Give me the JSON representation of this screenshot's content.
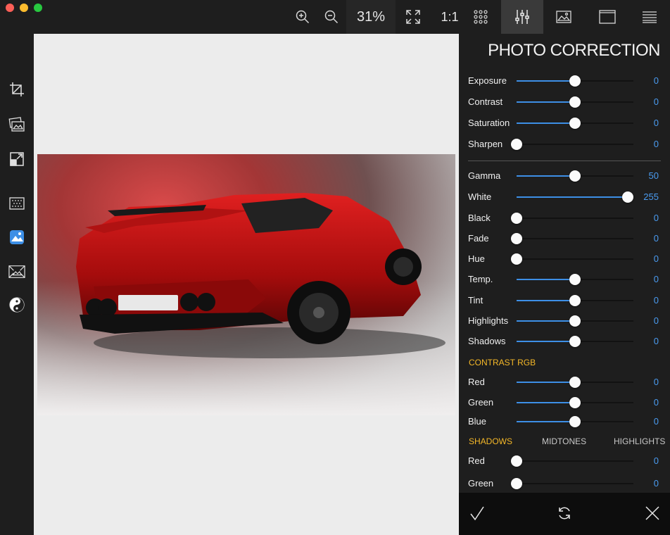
{
  "toolbar": {
    "zoom_in_icon": "zoom-in-icon",
    "zoom_out_icon": "zoom-out-icon",
    "zoom_level": "31%",
    "fit_icon": "fit-screen-icon",
    "actual_size": "1:1",
    "grid_icon": "grid-icon",
    "adjust_icon": "sliders-icon",
    "image_icon": "image-icon",
    "window_icon": "window-icon",
    "menu_icon": "menu-icon"
  },
  "sidebar": {
    "items": [
      {
        "icon": "crop-icon"
      },
      {
        "icon": "photo-effects-icon"
      },
      {
        "icon": "resize-icon"
      },
      {
        "icon": "texture-icon"
      },
      {
        "icon": "photo-correction-icon"
      },
      {
        "icon": "perspective-icon"
      },
      {
        "icon": "yin-yang-icon"
      }
    ]
  },
  "panel": {
    "title": "PHOTO CORRECTION",
    "basic": [
      {
        "label": "Exposure",
        "value": "0",
        "level": 0.5
      },
      {
        "label": "Contrast",
        "value": "0",
        "level": 0.5
      },
      {
        "label": "Saturation",
        "value": "0",
        "level": 0.5
      },
      {
        "label": "Sharpen",
        "value": "0",
        "level": 0.0
      }
    ],
    "tone": [
      {
        "label": "Gamma",
        "value": "50",
        "level": 0.5
      },
      {
        "label": "White",
        "value": "255",
        "level": 0.95
      },
      {
        "label": "Black",
        "value": "0",
        "level": 0.0
      },
      {
        "label": "Fade",
        "value": "0",
        "level": 0.0
      },
      {
        "label": "Hue",
        "value": "0",
        "level": 0.0
      },
      {
        "label": "Temp.",
        "value": "0",
        "level": 0.5
      },
      {
        "label": "Tint",
        "value": "0",
        "level": 0.5
      },
      {
        "label": "Highlights",
        "value": "0",
        "level": 0.5
      },
      {
        "label": "Shadows",
        "value": "0",
        "level": 0.5
      }
    ],
    "contrast_rgb_label": "CONTRAST RGB",
    "contrast_rgb": [
      {
        "label": "Red",
        "value": "0",
        "level": 0.5
      },
      {
        "label": "Green",
        "value": "0",
        "level": 0.5
      },
      {
        "label": "Blue",
        "value": "0",
        "level": 0.5
      }
    ],
    "tabs": {
      "shadows": "SHADOWS",
      "midtones": "MIDTONES",
      "highlights": "HIGHLIGHTS"
    },
    "shadows": [
      {
        "label": "Red",
        "value": "0",
        "level": 0.0
      },
      {
        "label": "Green",
        "value": "0",
        "level": 0.0
      }
    ]
  },
  "actions": {
    "confirm_icon": "checkmark-icon",
    "reset_icon": "refresh-icon",
    "cancel_icon": "close-icon"
  },
  "colors": {
    "accent": "#3d8fe6",
    "section": "#f5b828",
    "value": "#4a9bf0"
  }
}
